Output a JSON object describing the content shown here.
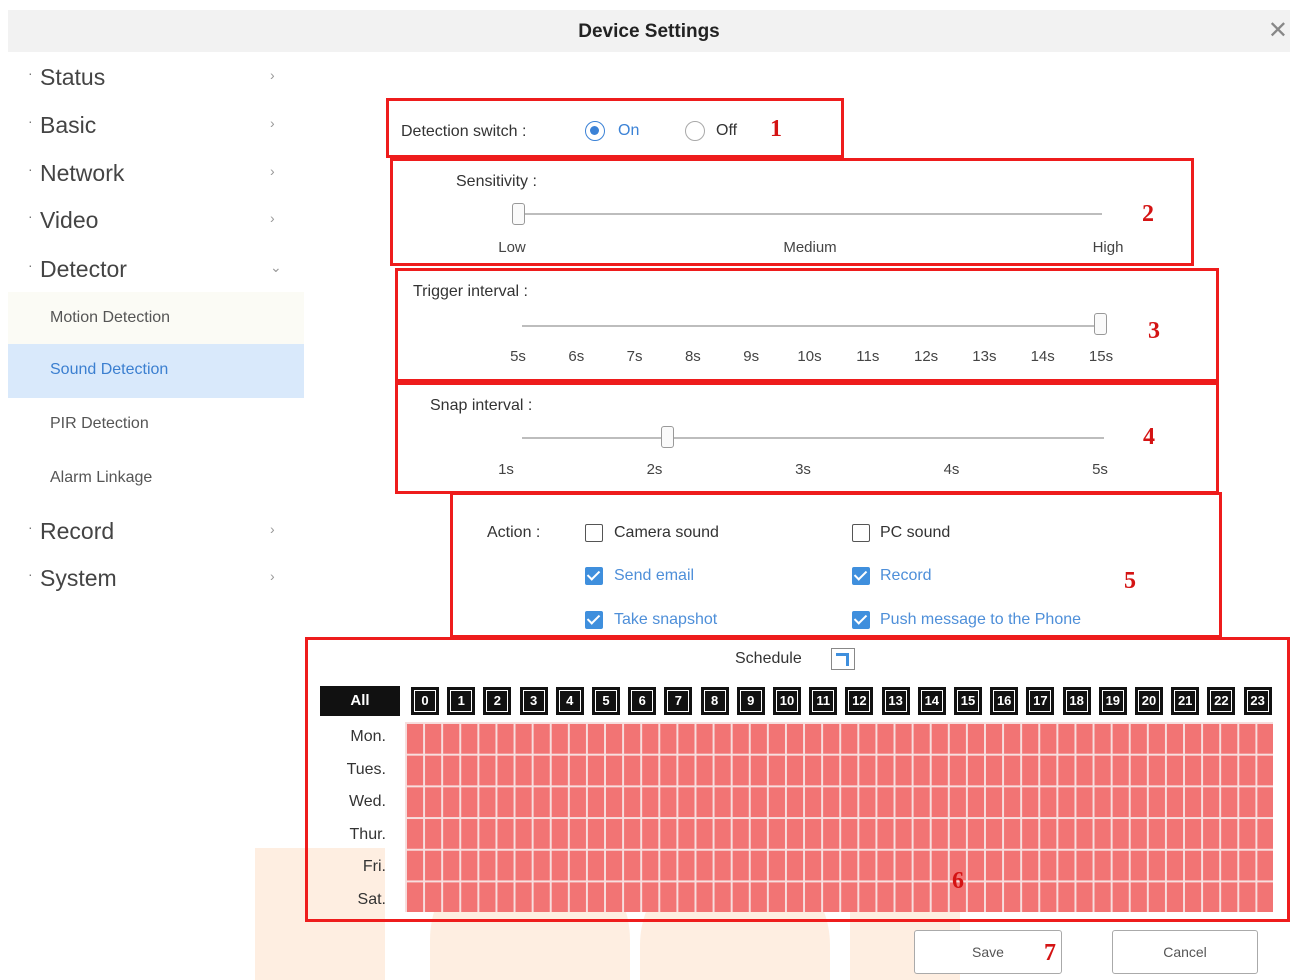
{
  "window": {
    "title": "Device Settings",
    "close_glyph": "✕"
  },
  "sidebar": {
    "items": [
      {
        "label": "Status",
        "chevron": "›"
      },
      {
        "label": "Basic",
        "chevron": "›"
      },
      {
        "label": "Network",
        "chevron": "›"
      },
      {
        "label": "Video",
        "chevron": "›"
      },
      {
        "label": "Detector",
        "chevron": "⌄"
      },
      {
        "label": "Record",
        "chevron": "›"
      },
      {
        "label": "System",
        "chevron": "›"
      }
    ],
    "sub_items": [
      {
        "label": "Motion Detection"
      },
      {
        "label": "Sound Detection",
        "active": true
      },
      {
        "label": "PIR Detection"
      },
      {
        "label": "Alarm Linkage"
      }
    ]
  },
  "detection_switch": {
    "label": "Detection switch :",
    "on_label": "On",
    "off_label": "Off",
    "selected": "On"
  },
  "sensitivity": {
    "label": "Sensitivity :",
    "ticks": [
      "Low",
      "Medium",
      "High"
    ],
    "value": "Low"
  },
  "trigger_interval": {
    "label": "Trigger interval :",
    "ticks": [
      "5s",
      "6s",
      "7s",
      "8s",
      "9s",
      "10s",
      "11s",
      "12s",
      "13s",
      "14s",
      "15s"
    ],
    "value": "15s"
  },
  "snap_interval": {
    "label": "Snap interval :",
    "ticks": [
      "1s",
      "2s",
      "3s",
      "4s",
      "5s"
    ],
    "value": "2s"
  },
  "action": {
    "label": "Action :",
    "options": [
      {
        "label": "Camera sound",
        "checked": false
      },
      {
        "label": "PC sound",
        "checked": false
      },
      {
        "label": "Send email",
        "checked": true
      },
      {
        "label": "Record",
        "checked": true
      },
      {
        "label": "Take snapshot",
        "checked": true
      },
      {
        "label": "Push message to the Phone",
        "checked": true
      }
    ]
  },
  "schedule": {
    "label": "Schedule",
    "all_label": "All",
    "hours": [
      "0",
      "1",
      "2",
      "3",
      "4",
      "5",
      "6",
      "7",
      "8",
      "9",
      "10",
      "11",
      "12",
      "13",
      "14",
      "15",
      "16",
      "17",
      "18",
      "19",
      "20",
      "21",
      "22",
      "23"
    ],
    "days": [
      "Mon.",
      "Tues.",
      "Wed.",
      "Thur.",
      "Fri.",
      "Sat."
    ],
    "all_selected": true
  },
  "buttons": {
    "save": "Save",
    "cancel": "Cancel"
  },
  "annotations": [
    "1",
    "2",
    "3",
    "4",
    "5",
    "6",
    "7"
  ],
  "colors": {
    "accent": "#3b82d6",
    "annotation_red": "#ee1c1c",
    "grid_fill": "#f27474",
    "active_bg": "#d9e9fb"
  }
}
